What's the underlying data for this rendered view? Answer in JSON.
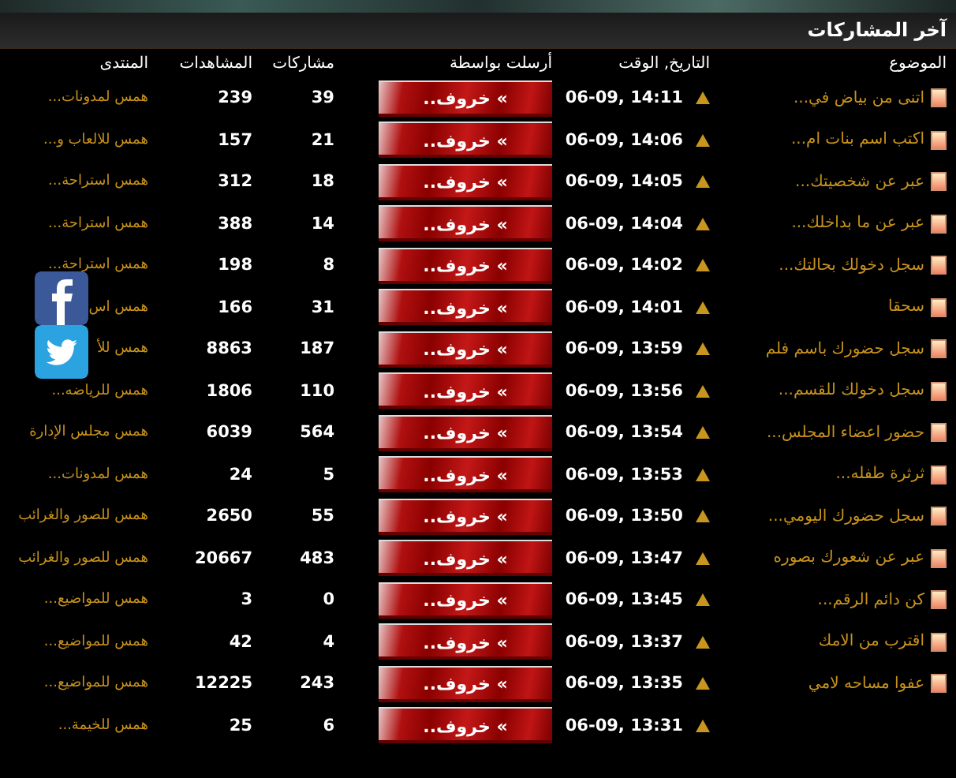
{
  "section": {
    "title": "آخر المشاركات"
  },
  "columns": [
    "الموضوع",
    "التاريخ, الوقت",
    "أرسلت بواسطة",
    "مشاركات",
    "المشاهدات",
    "المنتدى"
  ],
  "rows": [
    {
      "topic": "اتنى من بياض في...",
      "date": "06-09, 14:11",
      "poster": "» خروف..",
      "posts": "39",
      "views": "239",
      "forum": "همس لمدونات..."
    },
    {
      "topic": "اكتب اسم بنات ام...",
      "date": "06-09, 14:06",
      "poster": "» خروف..",
      "posts": "21",
      "views": "157",
      "forum": "همس للالعاب و..."
    },
    {
      "topic": "عبر عن شخصيتك...",
      "date": "06-09, 14:05",
      "poster": "» خروف..",
      "posts": "18",
      "views": "312",
      "forum": "همس استراحة..."
    },
    {
      "topic": "عبر عن ما بداخلك...",
      "date": "06-09, 14:04",
      "poster": "» خروف..",
      "posts": "14",
      "views": "388",
      "forum": "همس استراحة..."
    },
    {
      "topic": "سجل دخولك بحالتك...",
      "date": "06-09, 14:02",
      "poster": "» خروف..",
      "posts": "8",
      "views": "198",
      "forum": "همس استراحة..."
    },
    {
      "topic": "سحقا",
      "date": "06-09, 14:01",
      "poster": "» خروف..",
      "posts": "31",
      "views": "166",
      "forum": "همس اس"
    },
    {
      "topic": "سجل حضورك باسم فلم",
      "date": "06-09, 13:59",
      "poster": "» خروف..",
      "posts": "187",
      "views": "8863",
      "forum": "همس للأ"
    },
    {
      "topic": "سجل دخولك للقسم...",
      "date": "06-09, 13:56",
      "poster": "» خروف..",
      "posts": "110",
      "views": "1806",
      "forum": "همس للرياضه..."
    },
    {
      "topic": "حضور اعضاء المجلس...",
      "date": "06-09, 13:54",
      "poster": "» خروف..",
      "posts": "564",
      "views": "6039",
      "forum": "همس مجلس الإدارة"
    },
    {
      "topic": "ثرثرة طفله...",
      "date": "06-09, 13:53",
      "poster": "» خروف..",
      "posts": "5",
      "views": "24",
      "forum": "همس لمدونات..."
    },
    {
      "topic": "سجل حضورك اليومي...",
      "date": "06-09, 13:50",
      "poster": "» خروف..",
      "posts": "55",
      "views": "2650",
      "forum": "همس للصور والغرائب"
    },
    {
      "topic": "عبر عن شعورك بصوره",
      "date": "06-09, 13:47",
      "poster": "» خروف..",
      "posts": "483",
      "views": "20667",
      "forum": "همس للصور والغرائب"
    },
    {
      "topic": "كن دائم الرقم...",
      "date": "06-09, 13:45",
      "poster": "» خروف..",
      "posts": "0",
      "views": "3",
      "forum": "همس للمواضيع..."
    },
    {
      "topic": "اقترب من الامك",
      "date": "06-09, 13:37",
      "poster": "» خروف..",
      "posts": "4",
      "views": "42",
      "forum": "همس للمواضيع..."
    },
    {
      "topic": "عفوا مساحه لامي",
      "date": "06-09, 13:35",
      "poster": "» خروف..",
      "posts": "243",
      "views": "12225",
      "forum": "همس للمواضيع..."
    },
    {
      "date": "06-09, 13:31",
      "poster": "» خروف..",
      "posts": "6",
      "views": "25",
      "forum": "همس للخيمة..."
    }
  ]
}
